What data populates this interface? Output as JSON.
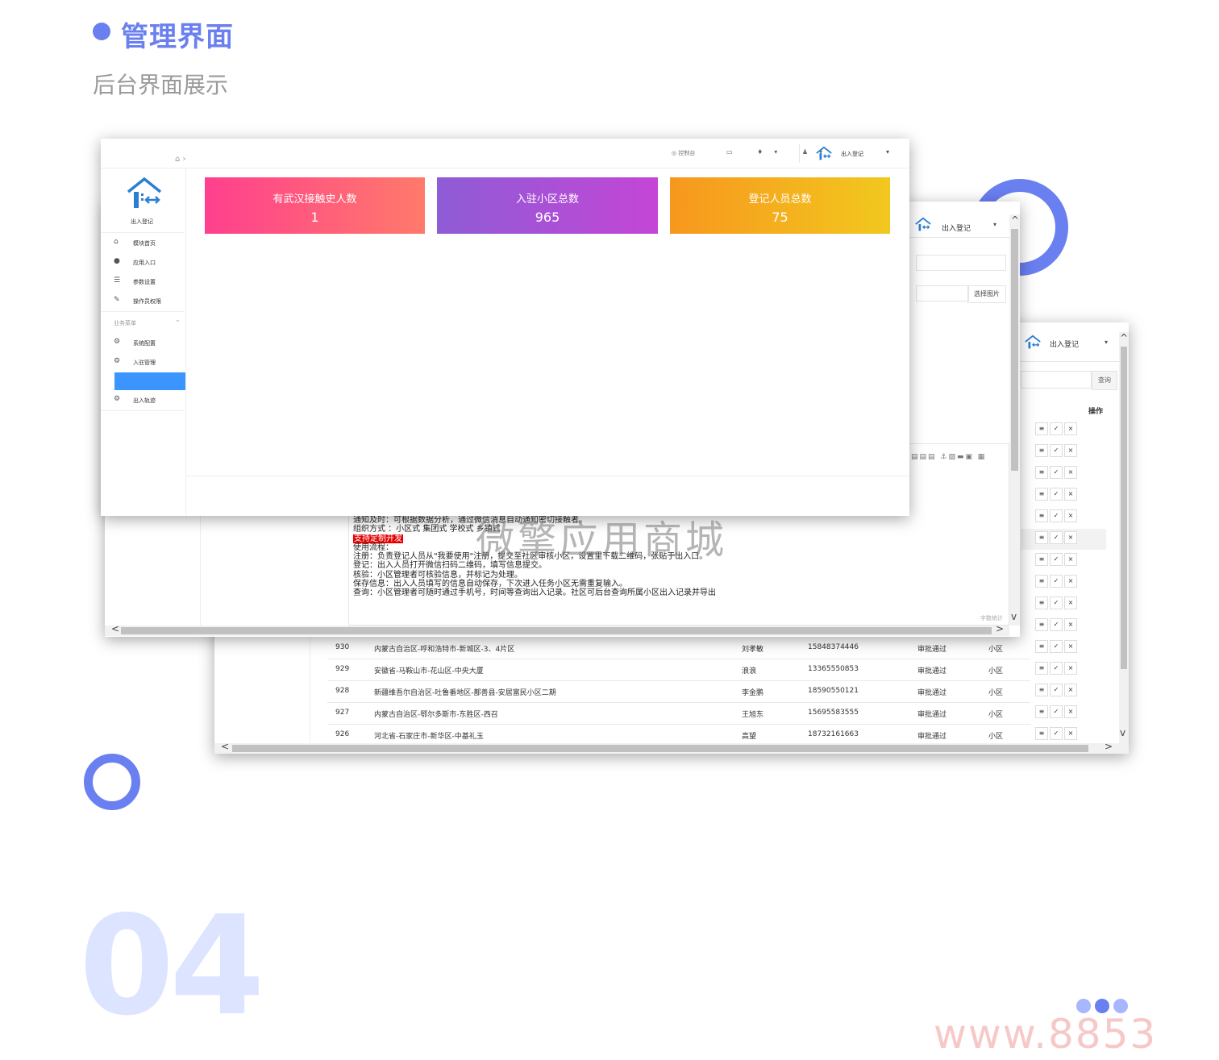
{
  "header": {
    "title": "管理界面",
    "subtitle": "后台界面展示"
  },
  "colors": {
    "accent": "#6a7ff0",
    "card_red": [
      "#ff3f8e",
      "#ff7a6a"
    ],
    "card_purple": [
      "#8e5cd6",
      "#c446d6"
    ],
    "card_orange": [
      "#f7971e",
      "#f2c81e"
    ],
    "active_menu": "#3a95ff"
  },
  "dashboard": {
    "nav": {
      "console": "控制台",
      "app_name": "出入登记"
    },
    "logo_label": "出入登记",
    "menu": [
      {
        "icon": "home-icon",
        "label": "模块首页"
      },
      {
        "icon": "chat-icon",
        "label": "应用入口"
      },
      {
        "icon": "list-icon",
        "label": "参数设置"
      },
      {
        "icon": "edit-icon",
        "label": "操作员权限"
      }
    ],
    "group_label": "业务菜单",
    "group_menu": [
      {
        "icon": "gear-icon",
        "label": "系统配置"
      },
      {
        "icon": "gear-icon",
        "label": "入驻管理"
      },
      {
        "icon": "gear-icon",
        "label": ""
      },
      {
        "icon": "gear-icon",
        "label": "出入轨迹"
      }
    ],
    "cards": [
      {
        "title": "有武汉接触史人数",
        "value": "1"
      },
      {
        "title": "入驻小区总数",
        "value": "965"
      },
      {
        "title": "登记人员总数",
        "value": "75"
      }
    ]
  },
  "editor_window": {
    "app_name": "出入登记",
    "pick_image": "选择图片",
    "word_count": "字数统计",
    "lines": [
      "通知及时：可根据数据分析，通过微信消息自动通知密切接触者。",
      "组织方式 ：小区式 集团式 学校式 乡镇式",
      "支持定制开发",
      "使用流程：",
      "注册：负责登记人员从\"我要使用\"注册，提交至社区审核小区，设置里下载二维码，张贴于出入口。",
      "登记：出入人员打开微信扫码二维码，填写信息提交。",
      "核验：小区管理者可核验信息，并标记为处理。",
      "保存信息：出入人员填写的信息自动保存，下次进入任务小区无需重复输入。",
      "查询：小区管理者可随时通过手机号，时间等查询出入记录。社区可后台查询所属小区出入记录并导出"
    ]
  },
  "table_window": {
    "app_name": "出入登记",
    "search_btn": "查询",
    "op_header": "操作",
    "rows": [
      {
        "id": "930",
        "address": "内蒙古自治区-呼和浩特市-新城区-3、4片区",
        "name": "刘孝敏",
        "phone": "15848374446",
        "status": "审批通过",
        "type": "小区"
      },
      {
        "id": "929",
        "address": "安徽省-马鞍山市-花山区-中央大厦",
        "name": "浪浪",
        "phone": "13365550853",
        "status": "审批通过",
        "type": "小区"
      },
      {
        "id": "928",
        "address": "新疆维吾尔自治区-吐鲁番地区-鄯善县-安居富民小区二期",
        "name": "李金鹏",
        "phone": "18590550121",
        "status": "审批通过",
        "type": "小区"
      },
      {
        "id": "927",
        "address": "内蒙古自治区-鄂尔多斯市-东胜区-西召",
        "name": "王旭东",
        "phone": "15695583555",
        "status": "审批通过",
        "type": "小区"
      },
      {
        "id": "926",
        "address": "河北省-石家庄市-新华区-中基礼玉",
        "name": "高望",
        "phone": "18732161663",
        "status": "审批通过",
        "type": "小区"
      }
    ],
    "action_icons": [
      "≡",
      "✓",
      "×"
    ]
  },
  "watermark": "微擎应用商城",
  "section_number": "04",
  "site_watermark": "www.8853"
}
